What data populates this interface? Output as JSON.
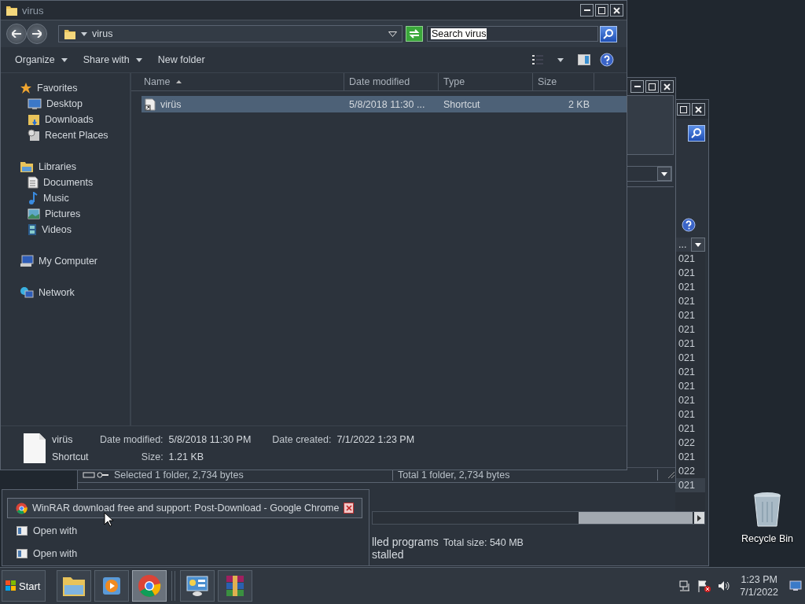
{
  "desktop_icons": [
    {
      "label": "Recycle Bin"
    }
  ],
  "explorer": {
    "title": "virus",
    "address": "virus",
    "search": {
      "value": "Search virus"
    },
    "toolbar": [
      {
        "label": "Organize",
        "dropdown": true
      },
      {
        "label": "Share with",
        "dropdown": true
      },
      {
        "label": "New folder",
        "dropdown": false
      }
    ],
    "nav": [
      {
        "label": "Favorites",
        "children": [
          {
            "label": "Desktop"
          },
          {
            "label": "Downloads"
          },
          {
            "label": "Recent Places"
          }
        ]
      },
      {
        "label": "Libraries",
        "children": [
          {
            "label": "Documents"
          },
          {
            "label": "Music"
          },
          {
            "label": "Pictures"
          },
          {
            "label": "Videos"
          }
        ]
      },
      {
        "label": "My Computer"
      },
      {
        "label": "Network"
      }
    ],
    "columns": [
      {
        "label": "Name",
        "sorted": true
      },
      {
        "label": "Date modified",
        "sorted": false
      },
      {
        "label": "Type",
        "sorted": false
      },
      {
        "label": "Size",
        "sorted": false
      }
    ],
    "rows": [
      {
        "name": "virüs",
        "date": "5/8/2018 11:30 ...",
        "type": "Shortcut",
        "size": "2 KB",
        "selected": true
      }
    ],
    "details": {
      "name": "virüs",
      "type": "Shortcut",
      "fields": [
        {
          "label": "Date modified:",
          "value": "5/8/2018 11:30 PM"
        },
        {
          "label": "Date created:",
          "value": "7/1/2022 1:23 PM"
        },
        {
          "label": "Size:",
          "value": "1.21 KB"
        }
      ]
    }
  },
  "window_2": {
    "status_bar": [
      "Selected 1 folder, 2,734 bytes",
      "Total 1 folder, 2,734 bytes"
    ]
  },
  "window_3": {
    "column_header": "...",
    "rows": [
      {
        "text": "021",
        "selected": false
      },
      {
        "text": "021",
        "selected": false
      },
      {
        "text": "021",
        "selected": false
      },
      {
        "text": "021",
        "selected": false
      },
      {
        "text": "021",
        "selected": false
      },
      {
        "text": "021",
        "selected": false
      },
      {
        "text": "021",
        "selected": false
      },
      {
        "text": "021",
        "selected": false
      },
      {
        "text": "021",
        "selected": false
      },
      {
        "text": "021",
        "selected": false
      },
      {
        "text": "021",
        "selected": false
      },
      {
        "text": "021",
        "selected": false
      },
      {
        "text": "021",
        "selected": false
      },
      {
        "text": "022",
        "selected": false
      },
      {
        "text": "021",
        "selected": false
      },
      {
        "text": "022",
        "selected": false
      },
      {
        "text": "021",
        "selected": true
      }
    ],
    "details": [
      [
        "lled programs",
        "Total size: 540 MB"
      ],
      [
        "stalled"
      ]
    ]
  },
  "jump_list": [
    {
      "kind": "window",
      "label": "WinRAR download free and support: Post-Download - Google Chrome",
      "selected": true
    },
    {
      "kind": "task",
      "label": "Open with",
      "selected": false
    },
    {
      "kind": "task",
      "label": "Open with",
      "selected": false
    }
  ],
  "taskbar": {
    "start": "Start",
    "apps": [
      {
        "selected": false
      },
      {
        "selected": false
      },
      {
        "selected": true
      },
      {
        "selected": false
      },
      {
        "selected": false
      }
    ],
    "clock": {
      "time": "1:23 PM",
      "date": "7/1/2022"
    }
  }
}
